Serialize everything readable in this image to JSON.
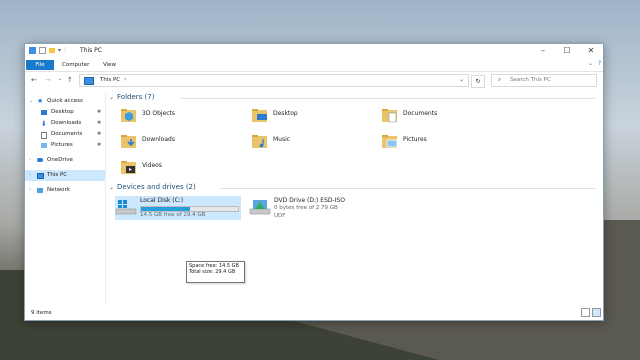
{
  "window": {
    "title": "This PC"
  },
  "ribbon": {
    "tabs": [
      "File",
      "Computer",
      "View"
    ]
  },
  "address": {
    "crumb": "This PC",
    "separator": "›",
    "search_placeholder": "Search This PC"
  },
  "nav": {
    "items": [
      {
        "label": "Quick access",
        "icon": "star-icon"
      },
      {
        "label": "Desktop",
        "icon": "desktop-icon",
        "pinned": true
      },
      {
        "label": "Downloads",
        "icon": "download-icon",
        "pinned": true
      },
      {
        "label": "Documents",
        "icon": "documents-icon",
        "pinned": true
      },
      {
        "label": "Pictures",
        "icon": "pictures-icon",
        "pinned": true
      },
      {
        "label": "OneDrive",
        "icon": "cloud-icon"
      },
      {
        "label": "This PC",
        "icon": "computer-icon",
        "selected": true
      },
      {
        "label": "Network",
        "icon": "network-icon"
      }
    ]
  },
  "folders": {
    "header": "Folders (7)",
    "items": [
      "3D Objects",
      "Desktop",
      "Documents",
      "Downloads",
      "Music",
      "Pictures",
      "Videos"
    ]
  },
  "devices": {
    "header": "Devices and drives (2)",
    "drives": [
      {
        "name": "Local Disk (C:)",
        "free_text": "14.5 GB free of 29.4 GB",
        "used_fraction": 0.51
      },
      {
        "name": "DVD Drive (D:) ESD-ISO",
        "free_text": "0 bytes free of 2.79 GB",
        "fs": "UDF"
      }
    ]
  },
  "tooltip": {
    "line1": "Space free: 14.5 GB",
    "line2": "Total size: 29.4 GB"
  },
  "status": {
    "items": "9 items"
  },
  "colors": {
    "accent": "#1979ca",
    "selection": "#cce8ff",
    "bar": "#26a0da"
  }
}
